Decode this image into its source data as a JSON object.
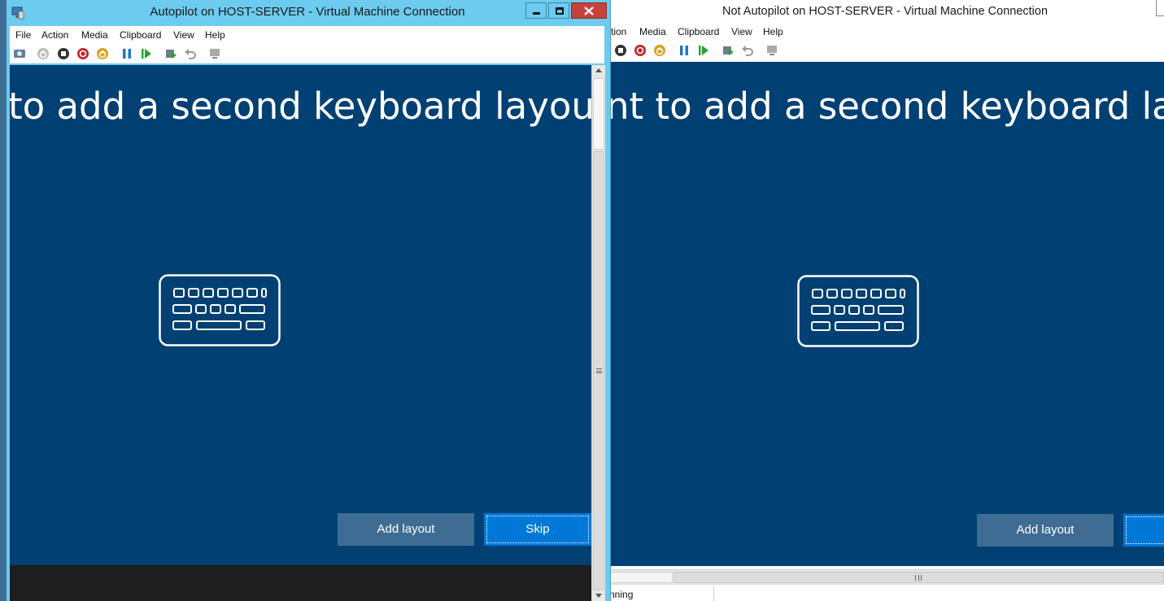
{
  "right_window": {
    "title": "Not Autopilot on HOST-SERVER - Virtual Machine Connection",
    "menu": [
      "tion",
      "Media",
      "Clipboard",
      "View",
      "Help"
    ],
    "question": "nt to add a second keyboard layout?",
    "add_layout": "Add layout",
    "status": "nning"
  },
  "left_window": {
    "title": "Autopilot on HOST-SERVER - Virtual Machine Connection",
    "menu": [
      "File",
      "Action",
      "Media",
      "Clipboard",
      "View",
      "Help"
    ],
    "question": "to add a second keyboard layout?",
    "add_layout": "Add layout",
    "skip": "Skip",
    "controls": {
      "minimize": "minimize-icon",
      "maximize": "maximize-icon",
      "close": "close-icon"
    }
  },
  "colors": {
    "oobe_background": "#014073",
    "titlebar_active": "#6ccbee",
    "add_button": "#3e6c93",
    "skip_button": "#0078d7",
    "close_button": "#c7413b"
  }
}
